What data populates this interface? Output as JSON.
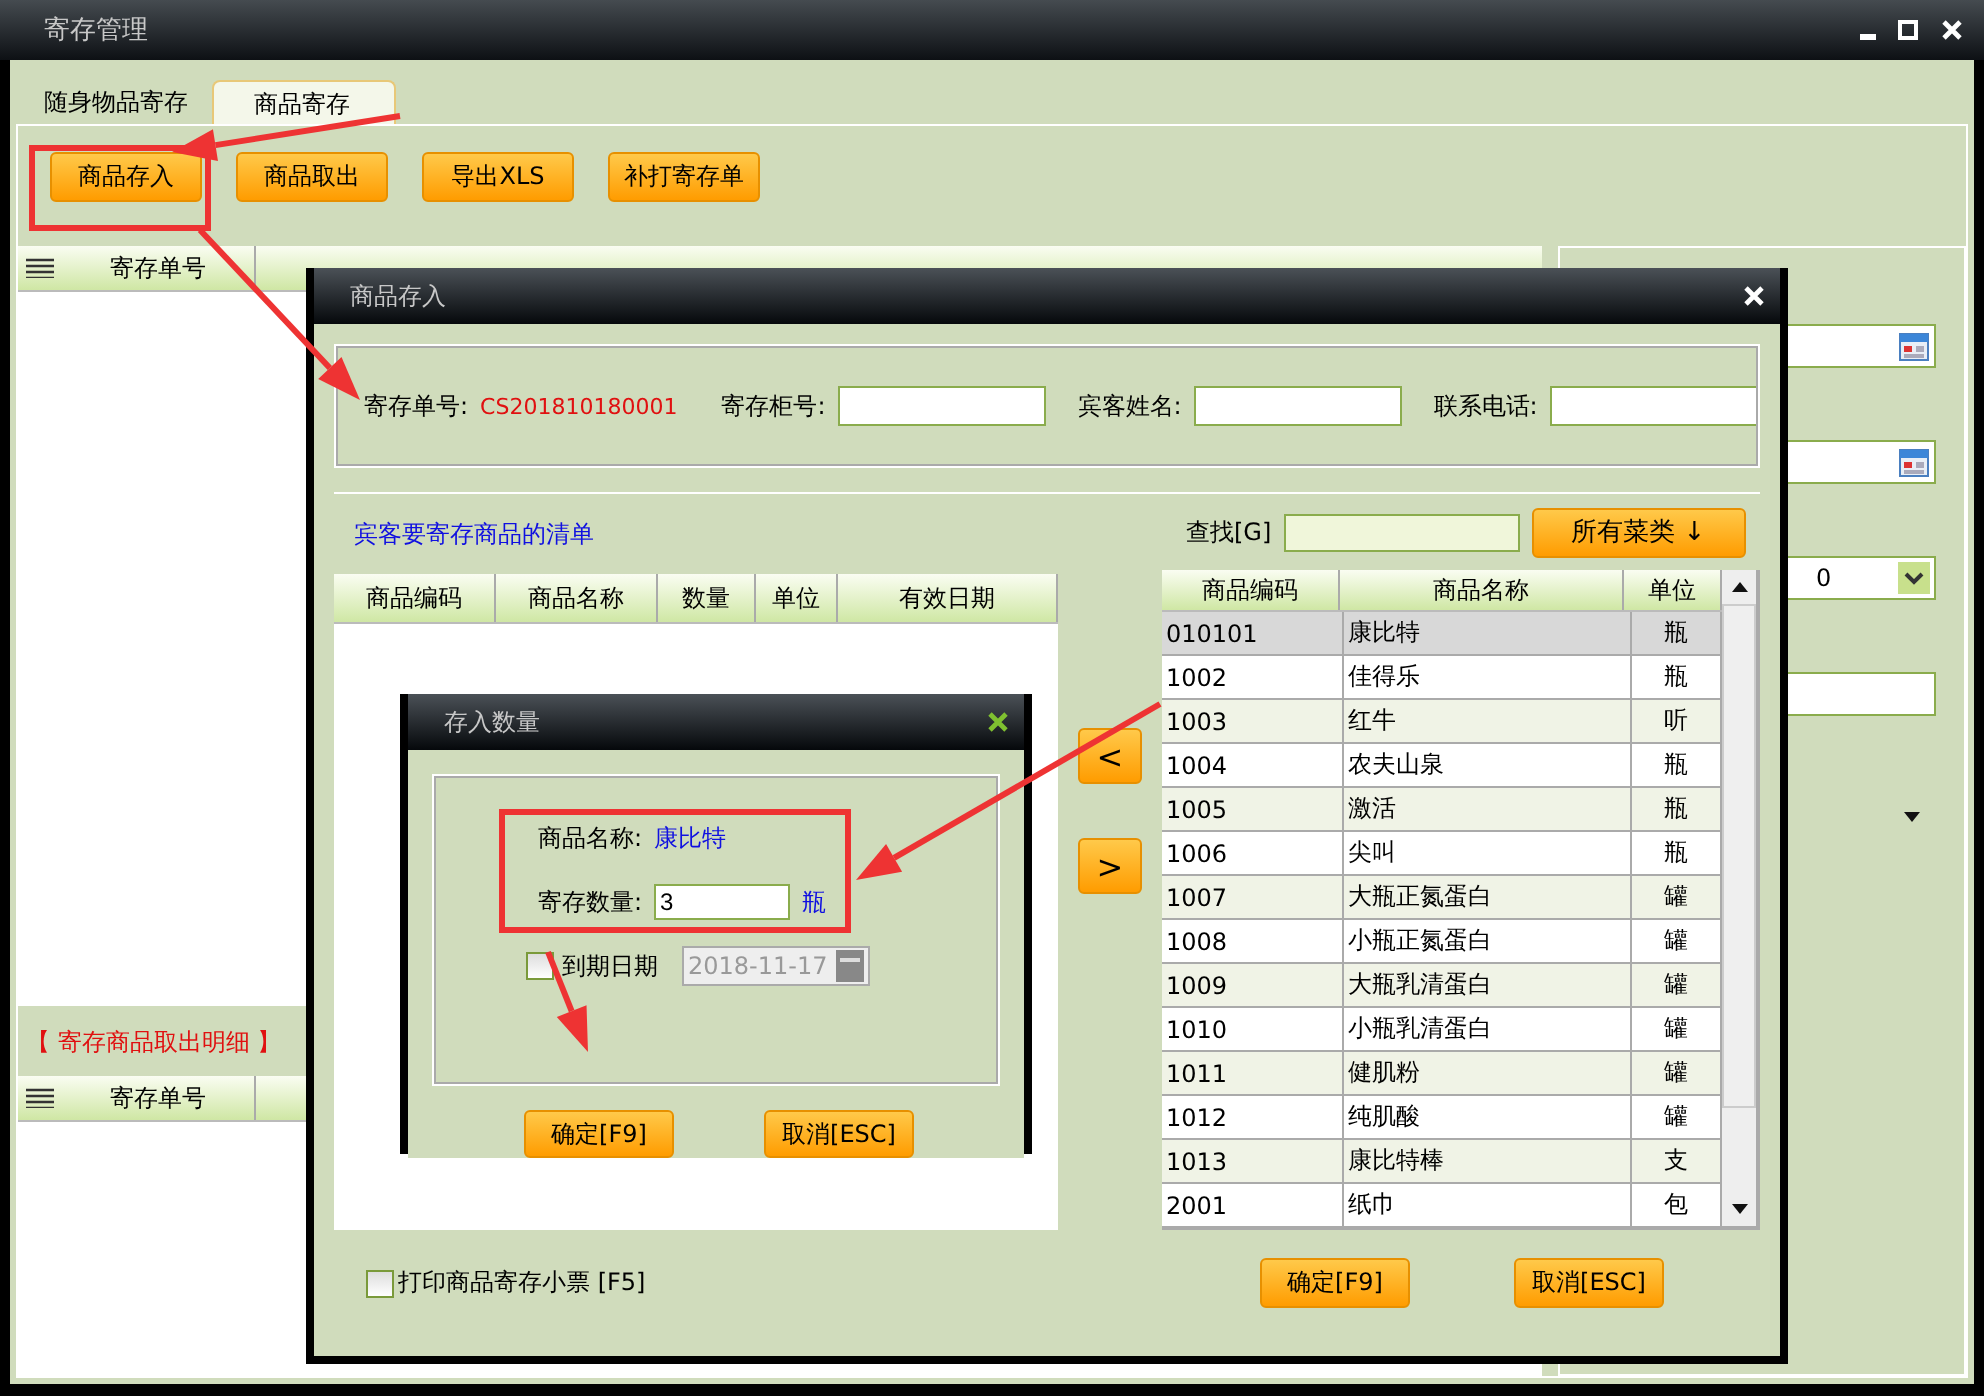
{
  "window": {
    "title": "寄存管理"
  },
  "tabs": [
    {
      "label": "随身物品寄存",
      "selected": false
    },
    {
      "label": "商品寄存",
      "selected": true
    }
  ],
  "toolbar": [
    "商品存入",
    "商品取出",
    "导出XLS",
    "补打寄存单"
  ],
  "main_table": {
    "columns": [
      "寄存单号"
    ]
  },
  "side_panel": {
    "dropdown_value": "0"
  },
  "detail_section": {
    "title": "【 寄存商品取出明细 】",
    "columns": [
      "寄存单号"
    ]
  },
  "deposit_dialog": {
    "title": "商品存入",
    "fields": [
      {
        "kind": "text",
        "label": "寄存单号:",
        "value": "CS201810180001"
      },
      {
        "kind": "input",
        "label": "寄存柜号:"
      },
      {
        "kind": "input",
        "label": "宾客姓名:"
      },
      {
        "kind": "input",
        "label": "联系电话:"
      }
    ],
    "list_title": "宾客要寄存商品的清单",
    "list_columns": [
      "商品编码",
      "商品名称",
      "数量",
      "单位",
      "有效日期"
    ],
    "move_buttons": [
      "<",
      ">"
    ],
    "search_label": "查找[G]",
    "category_button": "所有菜类 ↓",
    "goods_columns": [
      "商品编码",
      "商品名称",
      "单位"
    ],
    "goods_rows": [
      {
        "code": "010101",
        "name": "康比特",
        "unit": "瓶",
        "selected": true
      },
      {
        "code": "1002",
        "name": "佳得乐",
        "unit": "瓶",
        "selected": false
      },
      {
        "code": "1003",
        "name": "红牛",
        "unit": "听",
        "selected": false
      },
      {
        "code": "1004",
        "name": "农夫山泉",
        "unit": "瓶",
        "selected": false
      },
      {
        "code": "1005",
        "name": "激活",
        "unit": "瓶",
        "selected": false
      },
      {
        "code": "1006",
        "name": "尖叫",
        "unit": "瓶",
        "selected": false
      },
      {
        "code": "1007",
        "name": "大瓶正氮蛋白",
        "unit": "罐",
        "selected": false
      },
      {
        "code": "1008",
        "name": "小瓶正氮蛋白",
        "unit": "罐",
        "selected": false
      },
      {
        "code": "1009",
        "name": "大瓶乳清蛋白",
        "unit": "罐",
        "selected": false
      },
      {
        "code": "1010",
        "name": "小瓶乳清蛋白",
        "unit": "罐",
        "selected": false
      },
      {
        "code": "1011",
        "name": "健肌粉",
        "unit": "罐",
        "selected": false
      },
      {
        "code": "1012",
        "name": "纯肌酸",
        "unit": "罐",
        "selected": false
      },
      {
        "code": "1013",
        "name": "康比特棒",
        "unit": "支",
        "selected": false
      },
      {
        "code": "2001",
        "name": "纸巾",
        "unit": "包",
        "selected": false
      }
    ],
    "print_option": {
      "label": "打印商品寄存小票 [F5]",
      "checked": false
    },
    "buttons": [
      "确定[F9]",
      "取消[ESC]"
    ]
  },
  "quantity_dialog": {
    "title": "存入数量",
    "name_label": "商品名称:",
    "name_value": "康比特",
    "quantity_label": "寄存数量:",
    "quantity_value": "3",
    "unit": "瓶",
    "expiry": {
      "label": "到期日期",
      "checked": false,
      "value": "2018-11-17"
    },
    "buttons": [
      "确定[F9]",
      "取消[ESC]"
    ]
  }
}
